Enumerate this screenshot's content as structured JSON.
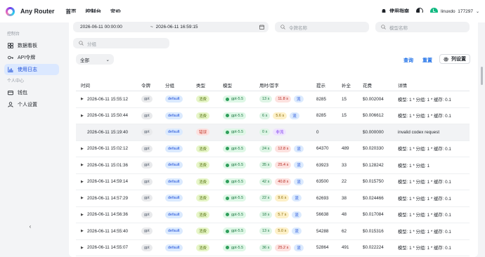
{
  "app": {
    "title": "Any Router"
  },
  "topnav": [
    "首页",
    "控制台",
    "定价"
  ],
  "header": {
    "docs": "使用指南",
    "user": {
      "avatar_letter": "L",
      "name": "linuxdo_177297"
    }
  },
  "sidebar": {
    "sections": [
      {
        "label": "控制台",
        "items": [
          "数据看板",
          "API令牌",
          "使用日志"
        ]
      },
      {
        "label": "个人中心",
        "items": [
          "钱包",
          "个人设置"
        ]
      }
    ],
    "active_item": "使用日志"
  },
  "filters": {
    "start_time": "2026-06-11 00:00:00",
    "separator": "~",
    "end_time": "2026-06-11 16:59:15",
    "token_placeholder": "令牌名称",
    "model_placeholder": "模型名称",
    "group_placeholder": "分组",
    "log_type": "全部",
    "query": "查询",
    "reset": "重置",
    "columns": "列设置"
  },
  "table": {
    "headers": [
      "时间",
      "令牌",
      "分组",
      "类型",
      "模型",
      "用时/首字",
      "提示",
      "补全",
      "花费",
      "详情"
    ],
    "rows": [
      {
        "time": "2026-06-11 15:55:12",
        "token": "gpt",
        "group": "default",
        "type": "消费",
        "model": "gpt-5.5",
        "use": "13 s",
        "first": "11.8 s",
        "stream": "流",
        "prompt": "8285",
        "completion": "15",
        "cost": "$0.002004",
        "detail": "模型: 1 * 分组: 1 * 缓存: 0.1",
        "expand": true
      },
      {
        "time": "2026-06-11 15:50:44",
        "token": "gpt",
        "group": "default",
        "type": "消费",
        "model": "gpt-5.5",
        "use": "6 s",
        "first": "5.6 s",
        "stream": "流",
        "prompt": "8285",
        "completion": "15",
        "cost": "$0.006612",
        "detail": "模型: 1 * 分组: 1 * 缓存: 0.1",
        "expand": true
      },
      {
        "time": "2026-06-11 15:19:40",
        "token": "gpt",
        "group": "default",
        "type": "错误",
        "model": "gpt-5.5",
        "use": "0 s",
        "first": "",
        "stream": "非流",
        "prompt": "0",
        "completion": "",
        "cost": "$0.000000",
        "detail": "invalid codex request",
        "expand": false
      },
      {
        "time": "2026-06-11 15:02:12",
        "token": "gpt",
        "group": "default",
        "type": "消费",
        "model": "gpt-5.5",
        "use": "24 s",
        "first": "12.8 s",
        "stream": "流",
        "prompt": "64370",
        "completion": "489",
        "cost": "$0.020330",
        "detail": "模型: 1 * 分组: 1 * 缓存: 0.1",
        "expand": true
      },
      {
        "time": "2026-06-11 15:01:36",
        "token": "gpt",
        "group": "default",
        "type": "消费",
        "model": "gpt-5.5",
        "use": "35 s",
        "first": "25.4 s",
        "stream": "流",
        "prompt": "63923",
        "completion": "33",
        "cost": "$0.128242",
        "detail": "模型: 1 * 分组: 1",
        "expand": true
      },
      {
        "time": "2026-06-11 14:59:14",
        "token": "gpt",
        "group": "default",
        "type": "消费",
        "model": "gpt-5.5",
        "use": "42 s",
        "first": "40.8 s",
        "stream": "流",
        "prompt": "63500",
        "completion": "22",
        "cost": "$0.015750",
        "detail": "模型: 1 * 分组: 1 * 缓存: 0.1",
        "expand": true
      },
      {
        "time": "2026-06-11 14:57:29",
        "token": "gpt",
        "group": "default",
        "type": "消费",
        "model": "gpt-5.5",
        "use": "22 s",
        "first": "9.6 s",
        "stream": "流",
        "prompt": "62693",
        "completion": "38",
        "cost": "$0.024466",
        "detail": "模型: 1 * 分组: 1 * 缓存: 0.1",
        "expand": true
      },
      {
        "time": "2026-06-11 14:56:36",
        "token": "gpt",
        "group": "default",
        "type": "消费",
        "model": "gpt-5.5",
        "use": "18 s",
        "first": "5.7 s",
        "stream": "流",
        "prompt": "56638",
        "completion": "48",
        "cost": "$0.017084",
        "detail": "模型: 1 * 分组: 1 * 缓存: 0.1",
        "expand": true
      },
      {
        "time": "2026-06-11 14:55:40",
        "token": "gpt",
        "group": "default",
        "type": "消费",
        "model": "gpt-5.5",
        "use": "13 s",
        "first": "5.0 s",
        "stream": "流",
        "prompt": "54288",
        "completion": "62",
        "cost": "$0.015316",
        "detail": "模型: 1 * 分组: 1 * 缓存: 0.1",
        "expand": true
      },
      {
        "time": "2026-06-11 14:55:07",
        "token": "gpt",
        "group": "default",
        "type": "消费",
        "model": "gpt-5.5",
        "use": "36 s",
        "first": "25.2 s",
        "stream": "流",
        "prompt": "52864",
        "completion": "491",
        "cost": "$0.022224",
        "detail": "模型: 1 * 分组: 1 * 缓存: 0.1",
        "expand": true
      }
    ]
  },
  "colors": {
    "accent": "#1d6fe8",
    "active_bg": "#dbe8ff"
  }
}
